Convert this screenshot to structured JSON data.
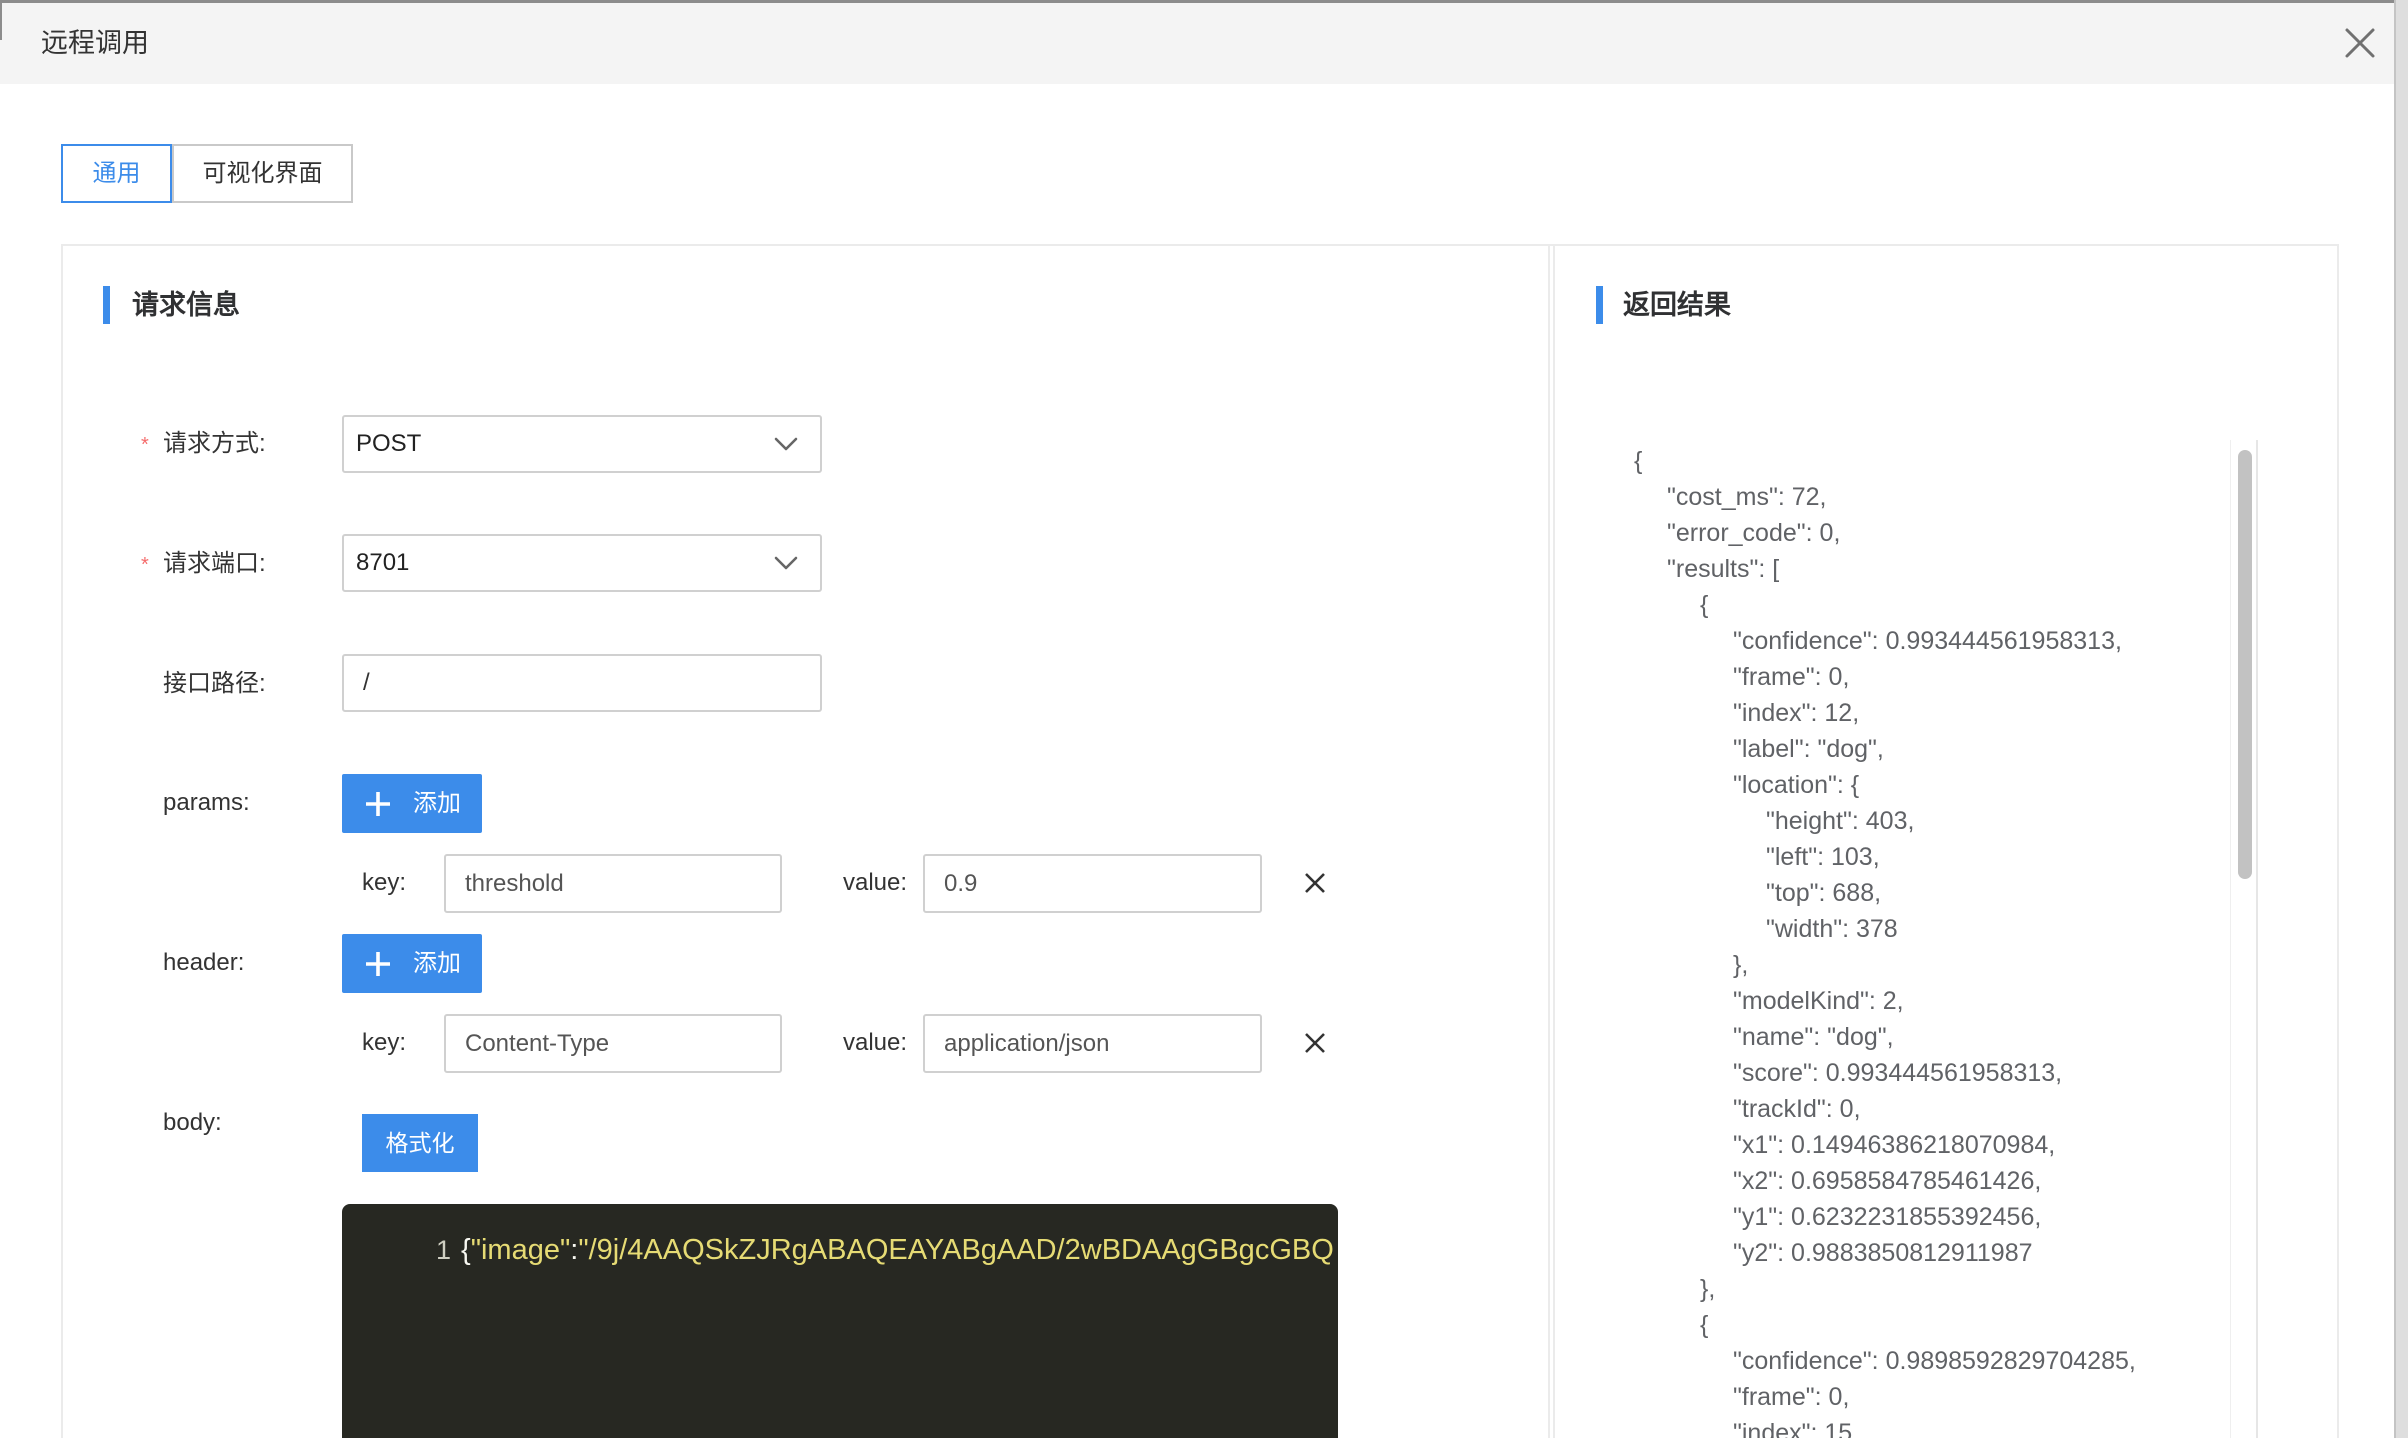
{
  "theme": {
    "accent": "#3c8cea",
    "required": "#f56c6c",
    "editor_bg": "#272822",
    "editor_string": "#e6db74",
    "editor_punctuation": "#f8f8f2"
  },
  "icons": {
    "close": "close-icon",
    "dropdown": "chevron-down-icon",
    "add": "plus-icon",
    "remove": "remove-icon"
  },
  "dialog": {
    "title": "远程调用"
  },
  "tabs": [
    {
      "label": "通用",
      "active": true
    },
    {
      "label": "可视化界面",
      "active": false
    }
  ],
  "request": {
    "section_title": "请求信息",
    "method": {
      "required_mark": "*",
      "label": "请求方式:",
      "value": "POST"
    },
    "port": {
      "required_mark": "*",
      "label": "请求端口:",
      "value": "8701"
    },
    "path": {
      "label": "接口路径:",
      "value": "/"
    },
    "params": {
      "label": "params:",
      "add_label": "添加",
      "rows": [
        {
          "key_label": "key:",
          "key": "threshold",
          "value_label": "value:",
          "value": "0.9"
        }
      ]
    },
    "header": {
      "label": "header:",
      "add_label": "添加",
      "rows": [
        {
          "key_label": "key:",
          "key": "Content-Type",
          "value_label": "value:",
          "value": "application/json"
        }
      ]
    },
    "body": {
      "label": "body:",
      "format_label": "格式化",
      "editor": {
        "line_number": "1",
        "open_brace": "{",
        "key": "\"image\"",
        "colon": ":",
        "value": "\"/9j/4AAQSkZJRgABAQEAYABgAAD/2wBDAAgGBgcGBQ"
      }
    }
  },
  "response": {
    "section_title": "返回结果",
    "lines": [
      "{",
      "    \"cost_ms\": 72,",
      "    \"error_code\": 0,",
      "    \"results\": [",
      "        {",
      "            \"confidence\": 0.993444561958313,",
      "            \"frame\": 0,",
      "            \"index\": 12,",
      "            \"label\": \"dog\",",
      "            \"location\": {",
      "                \"height\": 403,",
      "                \"left\": 103,",
      "                \"top\": 688,",
      "                \"width\": 378",
      "            },",
      "            \"modelKind\": 2,",
      "            \"name\": \"dog\",",
      "            \"score\": 0.993444561958313,",
      "            \"trackId\": 0,",
      "            \"x1\": 0.14946386218070984,",
      "            \"x2\": 0.6958584785461426,",
      "            \"y1\": 0.6232231855392456,",
      "            \"y2\": 0.9883850812911987",
      "        },",
      "        {",
      "            \"confidence\": 0.9898592829704285,",
      "            \"frame\": 0,",
      "            \"index\": 15"
    ]
  }
}
